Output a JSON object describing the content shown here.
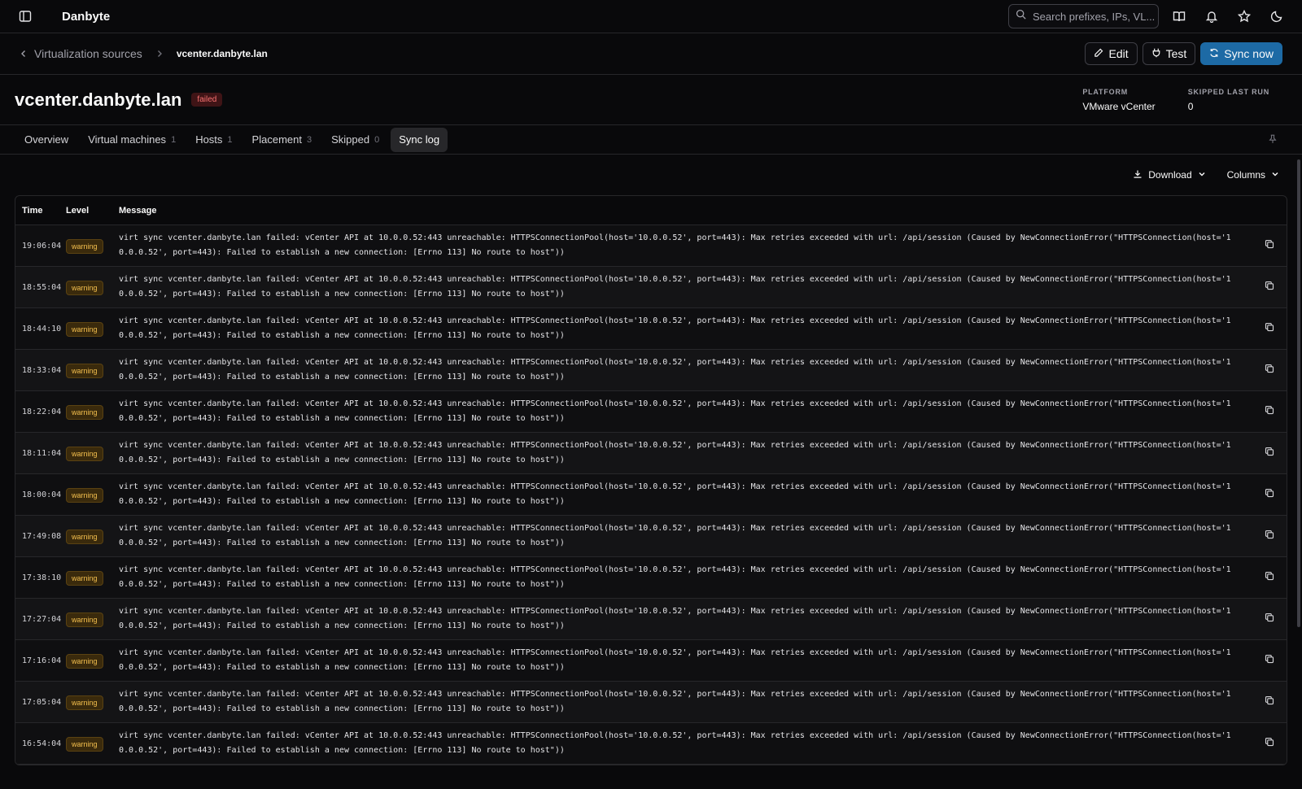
{
  "app": {
    "title": "Danbyte"
  },
  "search": {
    "placeholder": "Search prefixes, IPs, VL..."
  },
  "breadcrumb": {
    "parent": "Virtualization sources",
    "current": "vcenter.danbyte.lan"
  },
  "actions": {
    "edit": "Edit",
    "test": "Test",
    "sync": "Sync now"
  },
  "header": {
    "title": "vcenter.danbyte.lan",
    "status": "failed",
    "platform_label": "PLATFORM",
    "platform_value": "VMware vCenter",
    "skipped_label": "SKIPPED LAST RUN",
    "skipped_value": "0"
  },
  "tabs": [
    {
      "label": "Overview",
      "count": ""
    },
    {
      "label": "Virtual machines",
      "count": "1"
    },
    {
      "label": "Hosts",
      "count": "1"
    },
    {
      "label": "Placement",
      "count": "3"
    },
    {
      "label": "Skipped",
      "count": "0"
    },
    {
      "label": "Sync log",
      "count": ""
    }
  ],
  "toolbar": {
    "download": "Download",
    "columns": "Columns"
  },
  "table": {
    "headers": {
      "time": "Time",
      "level": "Level",
      "message": "Message"
    },
    "rows": [
      {
        "time": "19:06:04",
        "level": "warning",
        "message": "virt sync vcenter.danbyte.lan failed: vCenter API at 10.0.0.52:443 unreachable: HTTPSConnectionPool(host='10.0.0.52', port=443): Max retries exceeded with url: /api/session (Caused by NewConnectionError(\"HTTPSConnection(host='10.0.0.52', port=443): Failed to establish a new connection: [Errno 113] No route to host\"))"
      },
      {
        "time": "18:55:04",
        "level": "warning",
        "message": "virt sync vcenter.danbyte.lan failed: vCenter API at 10.0.0.52:443 unreachable: HTTPSConnectionPool(host='10.0.0.52', port=443): Max retries exceeded with url: /api/session (Caused by NewConnectionError(\"HTTPSConnection(host='10.0.0.52', port=443): Failed to establish a new connection: [Errno 113] No route to host\"))"
      },
      {
        "time": "18:44:10",
        "level": "warning",
        "message": "virt sync vcenter.danbyte.lan failed: vCenter API at 10.0.0.52:443 unreachable: HTTPSConnectionPool(host='10.0.0.52', port=443): Max retries exceeded with url: /api/session (Caused by NewConnectionError(\"HTTPSConnection(host='10.0.0.52', port=443): Failed to establish a new connection: [Errno 113] No route to host\"))"
      },
      {
        "time": "18:33:04",
        "level": "warning",
        "message": "virt sync vcenter.danbyte.lan failed: vCenter API at 10.0.0.52:443 unreachable: HTTPSConnectionPool(host='10.0.0.52', port=443): Max retries exceeded with url: /api/session (Caused by NewConnectionError(\"HTTPSConnection(host='10.0.0.52', port=443): Failed to establish a new connection: [Errno 113] No route to host\"))"
      },
      {
        "time": "18:22:04",
        "level": "warning",
        "message": "virt sync vcenter.danbyte.lan failed: vCenter API at 10.0.0.52:443 unreachable: HTTPSConnectionPool(host='10.0.0.52', port=443): Max retries exceeded with url: /api/session (Caused by NewConnectionError(\"HTTPSConnection(host='10.0.0.52', port=443): Failed to establish a new connection: [Errno 113] No route to host\"))"
      },
      {
        "time": "18:11:04",
        "level": "warning",
        "message": "virt sync vcenter.danbyte.lan failed: vCenter API at 10.0.0.52:443 unreachable: HTTPSConnectionPool(host='10.0.0.52', port=443): Max retries exceeded with url: /api/session (Caused by NewConnectionError(\"HTTPSConnection(host='10.0.0.52', port=443): Failed to establish a new connection: [Errno 113] No route to host\"))"
      },
      {
        "time": "18:00:04",
        "level": "warning",
        "message": "virt sync vcenter.danbyte.lan failed: vCenter API at 10.0.0.52:443 unreachable: HTTPSConnectionPool(host='10.0.0.52', port=443): Max retries exceeded with url: /api/session (Caused by NewConnectionError(\"HTTPSConnection(host='10.0.0.52', port=443): Failed to establish a new connection: [Errno 113] No route to host\"))"
      },
      {
        "time": "17:49:08",
        "level": "warning",
        "message": "virt sync vcenter.danbyte.lan failed: vCenter API at 10.0.0.52:443 unreachable: HTTPSConnectionPool(host='10.0.0.52', port=443): Max retries exceeded with url: /api/session (Caused by NewConnectionError(\"HTTPSConnection(host='10.0.0.52', port=443): Failed to establish a new connection: [Errno 113] No route to host\"))"
      },
      {
        "time": "17:38:10",
        "level": "warning",
        "message": "virt sync vcenter.danbyte.lan failed: vCenter API at 10.0.0.52:443 unreachable: HTTPSConnectionPool(host='10.0.0.52', port=443): Max retries exceeded with url: /api/session (Caused by NewConnectionError(\"HTTPSConnection(host='10.0.0.52', port=443): Failed to establish a new connection: [Errno 113] No route to host\"))"
      },
      {
        "time": "17:27:04",
        "level": "warning",
        "message": "virt sync vcenter.danbyte.lan failed: vCenter API at 10.0.0.52:443 unreachable: HTTPSConnectionPool(host='10.0.0.52', port=443): Max retries exceeded with url: /api/session (Caused by NewConnectionError(\"HTTPSConnection(host='10.0.0.52', port=443): Failed to establish a new connection: [Errno 113] No route to host\"))"
      },
      {
        "time": "17:16:04",
        "level": "warning",
        "message": "virt sync vcenter.danbyte.lan failed: vCenter API at 10.0.0.52:443 unreachable: HTTPSConnectionPool(host='10.0.0.52', port=443): Max retries exceeded with url: /api/session (Caused by NewConnectionError(\"HTTPSConnection(host='10.0.0.52', port=443): Failed to establish a new connection: [Errno 113] No route to host\"))"
      },
      {
        "time": "17:05:04",
        "level": "warning",
        "message": "virt sync vcenter.danbyte.lan failed: vCenter API at 10.0.0.52:443 unreachable: HTTPSConnectionPool(host='10.0.0.52', port=443): Max retries exceeded with url: /api/session (Caused by NewConnectionError(\"HTTPSConnection(host='10.0.0.52', port=443): Failed to establish a new connection: [Errno 113] No route to host\"))"
      },
      {
        "time": "16:54:04",
        "level": "warning",
        "message": "virt sync vcenter.danbyte.lan failed: vCenter API at 10.0.0.52:443 unreachable: HTTPSConnectionPool(host='10.0.0.52', port=443): Max retries exceeded with url: /api/session (Caused by NewConnectionError(\"HTTPSConnection(host='10.0.0.52', port=443): Failed to establish a new connection: [Errno 113] No route to host\"))"
      }
    ]
  },
  "colors": {
    "accent": "#1d6aa5",
    "failed": "#f87171",
    "warning": "#f5c04e",
    "background": "#09090b"
  }
}
